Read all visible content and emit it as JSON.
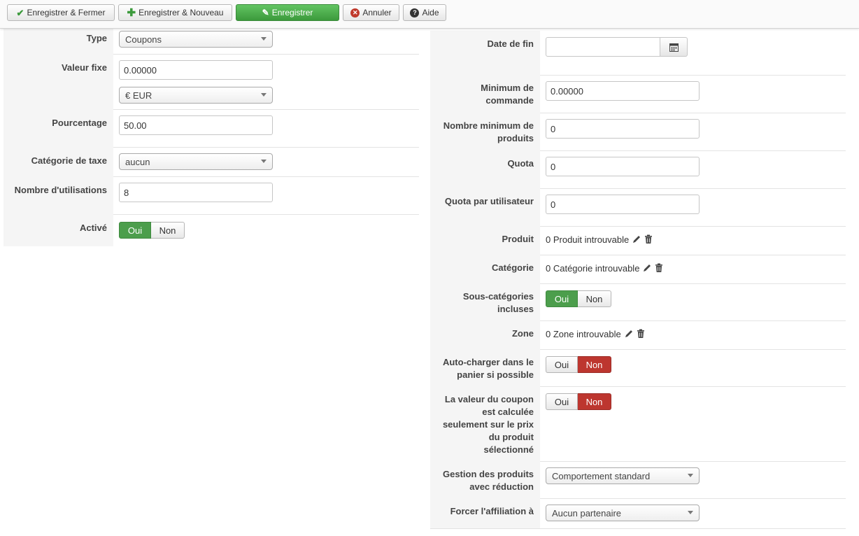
{
  "toolbar": {
    "save_close": "Enregistrer & Fermer",
    "save_new": "Enregistrer & Nouveau",
    "save": "Enregistrer",
    "cancel": "Annuler",
    "help": "Aide"
  },
  "left": {
    "type": {
      "label": "Type",
      "value": "Coupons"
    },
    "fixed_value": {
      "label": "Valeur fixe",
      "value": "0.00000",
      "currency": "€ EUR"
    },
    "percentage": {
      "label": "Pourcentage",
      "value": "50.00"
    },
    "tax_category": {
      "label": "Catégorie de taxe",
      "value": "aucun"
    },
    "uses": {
      "label": "Nombre d'utilisations",
      "value": "8"
    },
    "active": {
      "label": "Activé",
      "yes": "Oui",
      "no": "Non",
      "selected": "Oui"
    }
  },
  "right": {
    "end_date": {
      "label": "Date de fin",
      "value": ""
    },
    "min_order": {
      "label1": "Minimum de",
      "label2": "commande",
      "value": "0.00000"
    },
    "min_products": {
      "label1": "Nombre minimum de",
      "label2": "produits",
      "value": "0"
    },
    "quota": {
      "label": "Quota",
      "value": "0"
    },
    "quota_user": {
      "label": "Quota par utilisateur",
      "value": "0"
    },
    "product": {
      "label": "Produit",
      "value": "0 Produit introuvable"
    },
    "category": {
      "label": "Catégorie",
      "value": "0 Catégorie introuvable"
    },
    "subcat": {
      "label1": "Sous-catégories",
      "label2": "incluses",
      "yes": "Oui",
      "no": "Non",
      "selected": "Oui"
    },
    "zone": {
      "label": "Zone",
      "value": "0 Zone introuvable"
    },
    "autoload": {
      "label1": "Auto-charger dans le",
      "label2": "panier si possible",
      "yes": "Oui",
      "no": "Non",
      "selected": "Non"
    },
    "coupon_value": {
      "label1": "La valeur du coupon",
      "label2": "est calculée",
      "label3": "seulement sur le prix",
      "label4": "du produit",
      "label5": "sélectionné",
      "yes": "Oui",
      "no": "Non",
      "selected": "Non"
    },
    "discounted": {
      "label1": "Gestion des produits",
      "label2": "avec réduction",
      "value": "Comportement standard"
    },
    "affiliation": {
      "label": "Forcer l'affiliation à",
      "value": "Aucun partenaire"
    }
  },
  "colors": {
    "green": "#4c9e4c",
    "red": "#bd362f",
    "label_bg": "#f5f5f5"
  }
}
